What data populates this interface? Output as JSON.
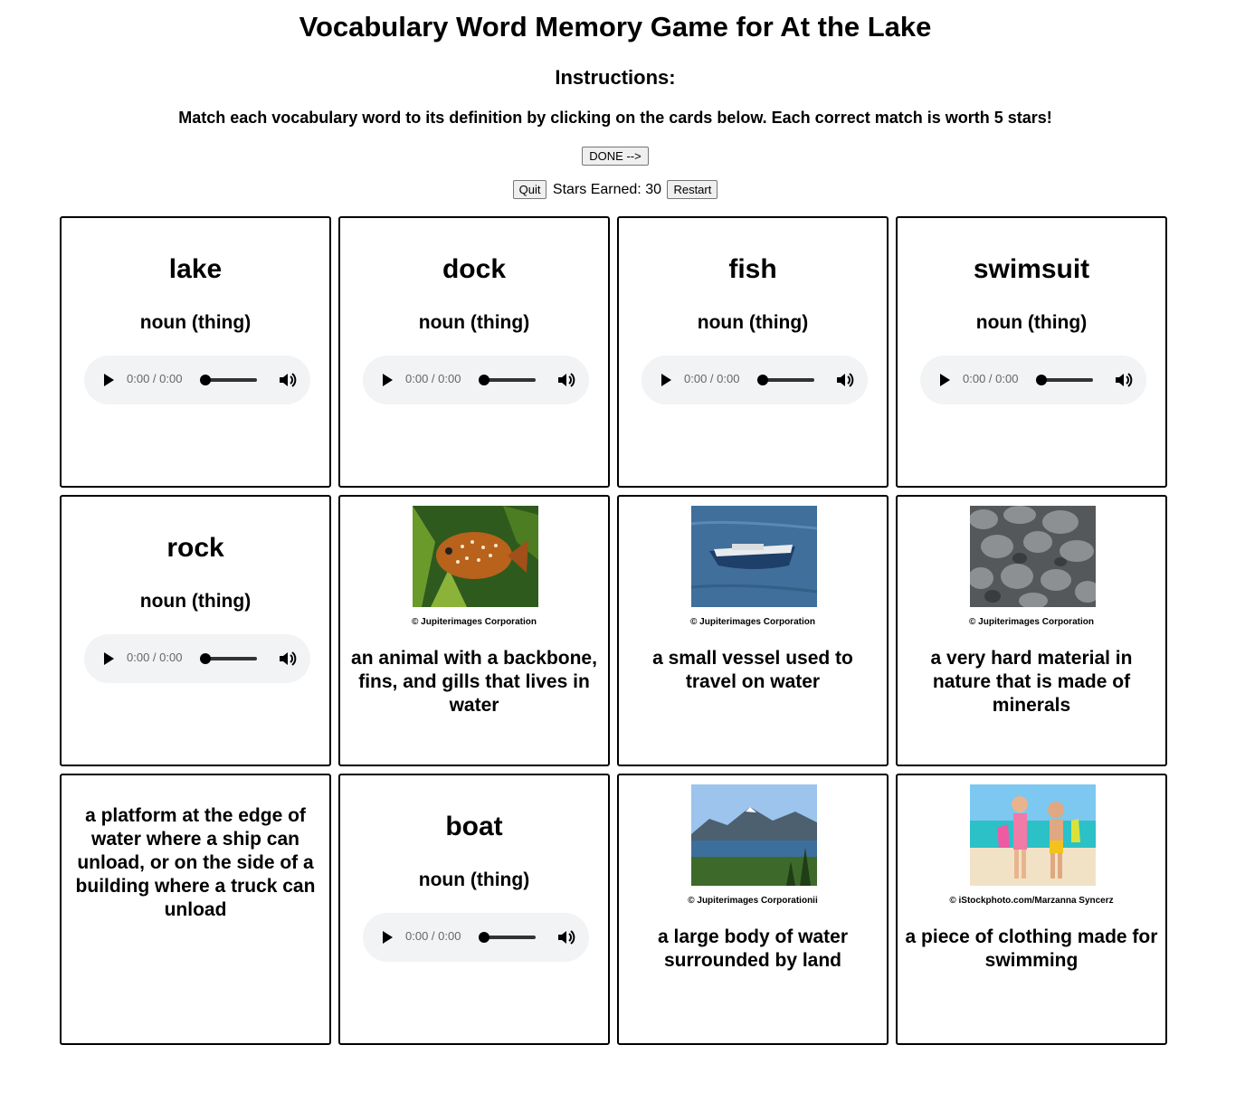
{
  "header": {
    "title": "Vocabulary Word Memory Game for At the Lake",
    "instructions_heading": "Instructions:",
    "instructions_text": "Match each vocabulary word to its definition by clicking on the cards below. Each correct match is worth 5 stars!",
    "done_label": "DONE -->"
  },
  "controls": {
    "quit_label": "Quit",
    "stars_text": "Stars Earned: 30",
    "restart_label": "Restart"
  },
  "cards": {
    "lake": {
      "word": "lake",
      "pos": "noun (thing)",
      "time": "0:00 / 0:00"
    },
    "dock": {
      "word": "dock",
      "pos": "noun (thing)",
      "time": "0:00 / 0:00"
    },
    "fish": {
      "word": "fish",
      "pos": "noun (thing)",
      "time": "0:00 / 0:00"
    },
    "swimsuit": {
      "word": "swimsuit",
      "pos": "noun (thing)",
      "time": "0:00 / 0:00"
    },
    "rock": {
      "word": "rock",
      "pos": "noun (thing)",
      "time": "0:00 / 0:00"
    },
    "fish_def": {
      "credit": "© Jupiterimages Corporation",
      "definition": "an animal with a backbone, fins, and gills that lives in water"
    },
    "boat_def": {
      "credit": "© Jupiterimages Corporation",
      "definition": "a small vessel used to travel on water"
    },
    "rock_def": {
      "credit": "© Jupiterimages Corporation",
      "definition": "a very hard material in nature that is made of minerals"
    },
    "dock_def": {
      "definition": "a platform at the edge of water where a ship can unload, or on the side of a building where a truck can unload"
    },
    "boat": {
      "word": "boat",
      "pos": "noun (thing)",
      "time": "0:00 / 0:00"
    },
    "lake_def": {
      "credit": "© Jupiterimages Corporationii",
      "definition": "a large body of water surrounded by land"
    },
    "swimsuit_def": {
      "credit": "© iStockphoto.com/Marzanna Syncerz",
      "definition": "a piece of clothing made for swimming"
    }
  },
  "icons": {
    "play": "play-icon",
    "volume": "volume-icon"
  }
}
